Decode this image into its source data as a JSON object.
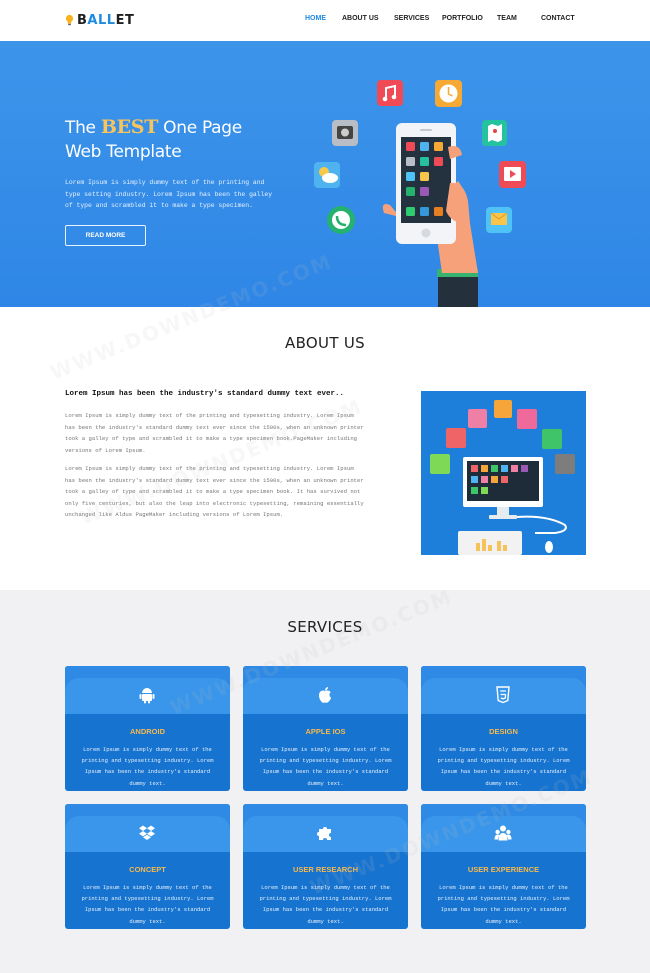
{
  "brand": {
    "logo_prefix": "B",
    "logo_highlight": "ALL",
    "logo_suffix": "ET"
  },
  "nav": {
    "items": [
      {
        "label": "HOME",
        "active": true
      },
      {
        "label": "ABOUT US",
        "active": false
      },
      {
        "label": "SERVICES",
        "active": false
      },
      {
        "label": "PORTFOLIO",
        "active": false
      },
      {
        "label": "TEAM",
        "active": false
      },
      {
        "label": "CONTACT",
        "active": false
      }
    ]
  },
  "hero": {
    "title_pre": "The ",
    "title_accent": "BEST",
    "title_post": " One Page",
    "title_line2": "Web Template",
    "text": "Lorem Ipsum is simply dummy text of the printing and type setting industry. Lorem Ipsum has been the galley of type and scrambled it to make a type specimen.",
    "button": "READ MORE"
  },
  "about": {
    "title": "ABOUT US",
    "subtitle": "Lorem Ipsum has been the industry's standard dummy text ever..",
    "p1": "Lorem Ipsum is simply dummy text of the printing and typesetting industry. Lorem Ipsum has been the industry's standard dummy text ever since the 1500s, when an unknown printer took a galley of type and scrambled it to make a type specimen book.PageMaker including versions of Lorem Ipsum.",
    "p2": "Lorem Ipsum is simply dummy text of the printing and typesetting industry. Lorem Ipsum has been the industry's standard dummy text ever since the 1500s, when an unknown printer took a galley of type and scrambled it to make a type specimen book. It has survived not only five centuries, but also the leap into electronic typesetting, remaining essentially unchanged like Aldus PageMaker including versions of Lorem Ipsum."
  },
  "services": {
    "title": "SERVICES",
    "cards": [
      {
        "title": "ANDROID",
        "icon": "android-icon",
        "text": "Lorem Ipsum is simply dummy text of the printing and typesetting industry. Lorem Ipsum has been the industry's standard dummy text."
      },
      {
        "title": "APPLE IOS",
        "icon": "apple-icon",
        "text": "Lorem Ipsum is simply dummy text of the printing and typesetting industry. Lorem Ipsum has been the industry's standard dummy text."
      },
      {
        "title": "DESIGN",
        "icon": "html5-icon",
        "text": "Lorem Ipsum is simply dummy text of the printing and typesetting industry. Lorem Ipsum has been the industry's standard dummy text."
      },
      {
        "title": "CONCEPT",
        "icon": "dropbox-icon",
        "text": "Lorem Ipsum is simply dummy text of the printing and typesetting industry. Lorem Ipsum has been the industry's standard dummy text."
      },
      {
        "title": "USER RESEARCH",
        "icon": "puzzle-icon",
        "text": "Lorem Ipsum is simply dummy text of the printing and typesetting industry. Lorem Ipsum has been the industry's standard dummy text."
      },
      {
        "title": "USER EXPERIENCE",
        "icon": "users-icon",
        "text": "Lorem Ipsum is simply dummy text of the printing and typesetting industry. Lorem Ipsum has been the industry's standard dummy text."
      }
    ]
  },
  "watermark": "WWW.DOWNDEMO.COM",
  "colors": {
    "accent": "#1e88e5",
    "hero_bg": "#3a92e9",
    "highlight": "#f9c55b",
    "card_bg": "#1673cf",
    "card_title": "#f7b94d"
  }
}
